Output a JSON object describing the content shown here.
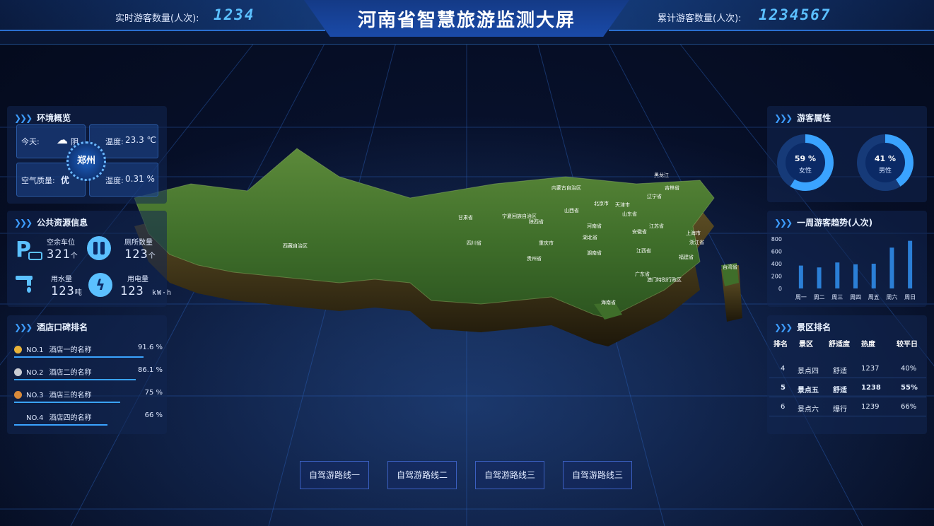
{
  "header": {
    "title": "河南省智慧旅游监测大屏",
    "realtime_label": "实时游客数量(人次):",
    "realtime_value": "1234",
    "total_label": "累计游客数量(人次):",
    "total_value": "1234567"
  },
  "environment": {
    "title": "环境概览",
    "today_label": "今天:",
    "weather": "阴",
    "temperature_label": "温度:",
    "temperature_value": "23.3 ℃",
    "air_quality_label": "空气质量:",
    "air_quality_value": "优",
    "humidity_label": "湿度:",
    "humidity_value": "0.31 %",
    "city": "郑州"
  },
  "resources": {
    "title": "公共资源信息",
    "parking_label": "空余车位",
    "parking_value": "321",
    "parking_unit": "个",
    "toilet_label": "厕所数量",
    "toilet_value": "123",
    "toilet_unit": "个",
    "water_label": "用水量",
    "water_value": "123",
    "water_unit": "吨",
    "power_label": "用电量",
    "power_value": "123",
    "power_unit": "kW·h"
  },
  "hotels": {
    "title": "酒店口碑排名",
    "items": [
      {
        "rank": "NO.1",
        "name": "酒店一的名称",
        "pct": "91.6 %",
        "value": 91.6
      },
      {
        "rank": "NO.2",
        "name": "酒店二的名称",
        "pct": "86.1 %",
        "value": 86.1
      },
      {
        "rank": "NO.3",
        "name": "酒店三的名称",
        "pct": "75 %",
        "value": 75
      },
      {
        "rank": "NO.4",
        "name": "酒店四的名称",
        "pct": "66 %",
        "value": 66
      }
    ]
  },
  "visitors": {
    "title": "游客属性",
    "female_pct": "59 %",
    "female_label": "女性",
    "female_value": 59,
    "male_pct": "41 %",
    "male_label": "男性",
    "male_value": 41
  },
  "chart_data": {
    "type": "bar",
    "title": "一周游客趋势(人次)",
    "categories": [
      "周一",
      "周二",
      "周三",
      "周四",
      "周五",
      "周六",
      "周日"
    ],
    "values": [
      370,
      340,
      420,
      390,
      400,
      660,
      770
    ],
    "yticks": [
      "800",
      "600",
      "400",
      "200",
      "0"
    ],
    "ylim": [
      0,
      800
    ]
  },
  "scenic": {
    "title": "景区排名",
    "headers": [
      "排名",
      "景区",
      "舒适度",
      "热度",
      "较平日"
    ],
    "rows": [
      [
        "4",
        "景点四",
        "舒适",
        "1237",
        "40%"
      ],
      [
        "5",
        "景点五",
        "舒适",
        "1238",
        "55%"
      ],
      [
        "6",
        "景点六",
        "爆行",
        "1239",
        "66%"
      ]
    ]
  },
  "map": {
    "labels": [
      "黑龙江",
      "吉林省",
      "辽宁省",
      "内蒙古自治区",
      "北京市",
      "天津市",
      "山西省",
      "山东省",
      "宁夏回族自治区",
      "甘肃省",
      "陕西省",
      "河南省",
      "江苏省",
      "上海市",
      "安徽省",
      "湖北省",
      "浙江省",
      "西藏自治区",
      "四川省",
      "重庆市",
      "湖南省",
      "江西省",
      "贵州省",
      "福建省",
      "台湾省",
      "广东省",
      "澳门特别行政区",
      "海南省"
    ]
  },
  "routes": [
    "自驾游路线一",
    "自驾游路线二",
    "自驾游路线三",
    "自驾游路线三"
  ],
  "colors": {
    "accent": "#3aa3ff",
    "bar": "#2b7fd6",
    "background": "#07102a"
  }
}
